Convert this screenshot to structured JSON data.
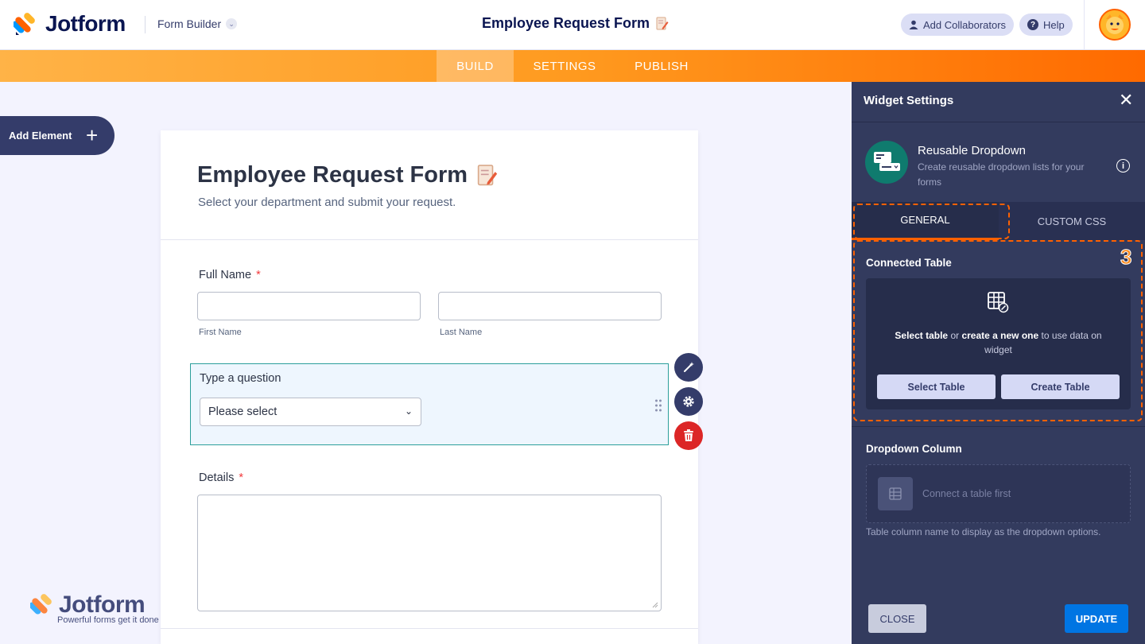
{
  "header": {
    "logo_text": "Jotform",
    "builder_label": "Form Builder",
    "form_title": "Employee Request Form",
    "add_collaborators": "Add Collaborators",
    "help": "Help"
  },
  "nav": {
    "tabs": [
      {
        "label": "BUILD",
        "active": true
      },
      {
        "label": "SETTINGS",
        "active": false
      },
      {
        "label": "PUBLISH",
        "active": false
      }
    ]
  },
  "sidebar": {
    "add_element": "Add Element"
  },
  "form": {
    "title": "Employee Request Form",
    "subtitle": "Select your department and submit your request.",
    "full_name_label": "Full Name",
    "required_mark": "*",
    "first_name_sublabel": "First Name",
    "last_name_sublabel": "Last Name",
    "question_label": "Type a question",
    "select_placeholder": "Please select",
    "details_label": "Details"
  },
  "watermark": {
    "text": "Jotform",
    "tagline": "Powerful forms get it done"
  },
  "panel": {
    "title": "Widget Settings",
    "widget_name": "Reusable Dropdown",
    "widget_desc": "Create reusable dropdown lists for your forms",
    "tabs": [
      {
        "label": "GENERAL",
        "active": true
      },
      {
        "label": "CUSTOM CSS",
        "active": false
      }
    ],
    "step_number": "3",
    "connected_table_title": "Connected Table",
    "connect_msg_select": "Select table",
    "connect_msg_or": " or ",
    "connect_msg_create": "create a new one",
    "connect_msg_rest": " to use data on widget",
    "select_table_btn": "Select Table",
    "create_table_btn": "Create Table",
    "dropdown_column_title": "Dropdown Column",
    "connect_first": "Connect a table first",
    "column_help": "Table column name to display as the dropdown options.",
    "close_btn": "CLOSE",
    "update_btn": "UPDATE"
  },
  "colors": {
    "accent_orange": "#ff6100",
    "primary_blue": "#0075e3",
    "panel_bg": "#333b5e",
    "delete_red": "#dc2626",
    "selected_border": "#2b9f9b"
  }
}
